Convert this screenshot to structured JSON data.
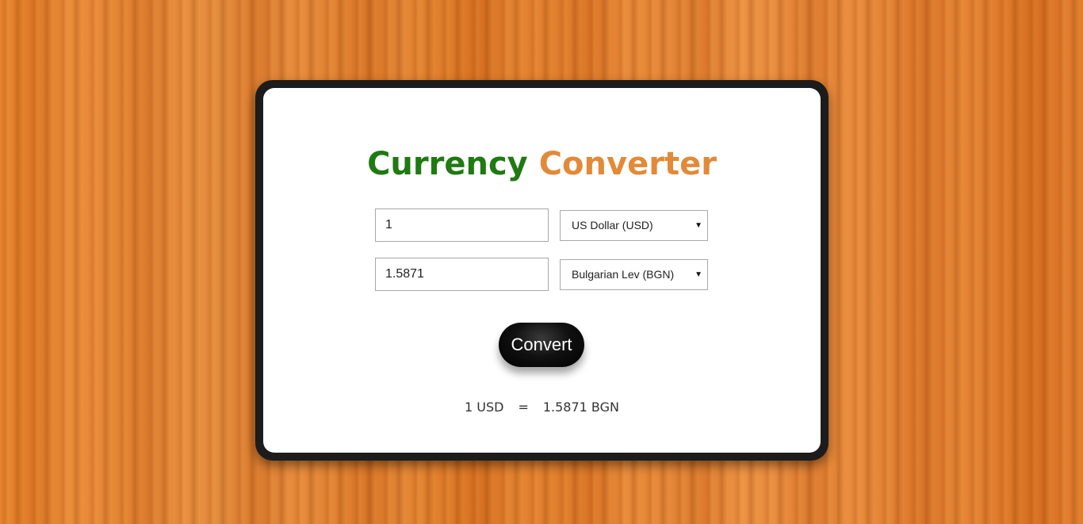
{
  "title": {
    "word1": "Currency",
    "word2": "Converter",
    "color_word1": "#1f7a12",
    "color_word2": "#e28a38"
  },
  "from": {
    "amount": "1",
    "currency": "US Dollar (USD)"
  },
  "to": {
    "amount": "1.5871",
    "currency": "Bulgarian Lev (BGN)"
  },
  "convert_label": "Convert",
  "result": {
    "left": "1 USD",
    "equals": "=",
    "right": "1.5871 BGN"
  }
}
